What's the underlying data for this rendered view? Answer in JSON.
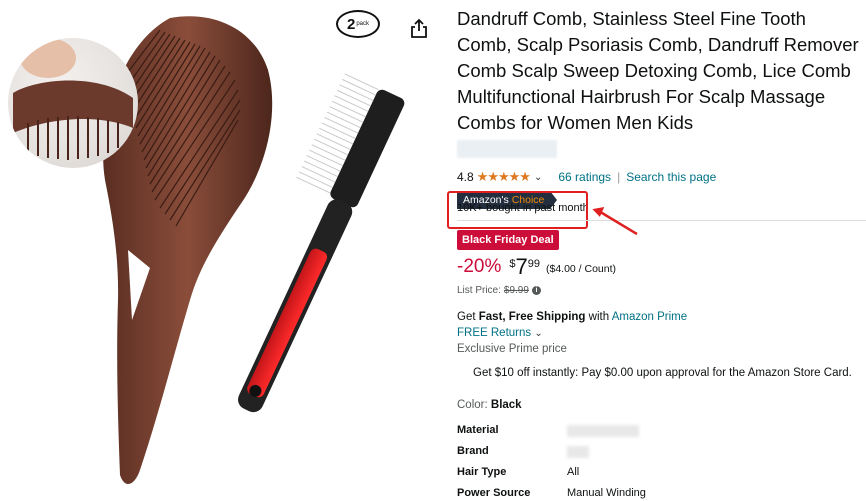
{
  "product": {
    "pack_badge": {
      "number": "2",
      "text": "pack"
    },
    "title": "Dandruff Comb, Stainless Steel Fine Tooth Comb, Scalp Psoriasis Comb, Dandruff Remover Comb Scalp Sweep Detoxing Comb, Lice Comb Multifunctional Hairbrush For Scalp Massage Combs for Women Men Kids",
    "rating": "4.8",
    "stars": "★★★★★",
    "ratings_count": "66 ratings",
    "search_link": "Search this page",
    "choice_badge": {
      "prefix": "Amazon's",
      "choice": "Choice"
    },
    "bought": "10K+ bought in past month",
    "deal_badge": "Black Friday Deal",
    "price": {
      "discount": "-20%",
      "symbol": "$",
      "whole": "7",
      "fraction": "99",
      "unit": "($4.00 / Count)"
    },
    "list_price": {
      "label": "List Price:",
      "value": "$9.99"
    },
    "shipping": {
      "get": "Get",
      "bold": "Fast, Free Shipping",
      "with": "with",
      "link": "Amazon Prime"
    },
    "returns": "FREE Returns",
    "prime_price": "Exclusive Prime price",
    "store_card": "Get $10 off instantly: Pay $0.00 upon approval for the Amazon Store Card.",
    "color": {
      "label": "Color:",
      "value": "Black"
    },
    "specs": [
      {
        "key": "Material",
        "value": ""
      },
      {
        "key": "Brand",
        "value": ""
      },
      {
        "key": "Hair Type",
        "value": "All"
      },
      {
        "key": "Power Source",
        "value": "Manual Winding"
      }
    ]
  },
  "colors": {
    "link": "#007185",
    "star": "#de7921",
    "deal": "#cc0c39",
    "badge_bg": "#232f3e",
    "choice": "#f08804",
    "highlight_box": "#e02020"
  },
  "icons": [
    "share-icon",
    "chevron-down-icon",
    "info-icon",
    "red-arrow-annotation"
  ]
}
